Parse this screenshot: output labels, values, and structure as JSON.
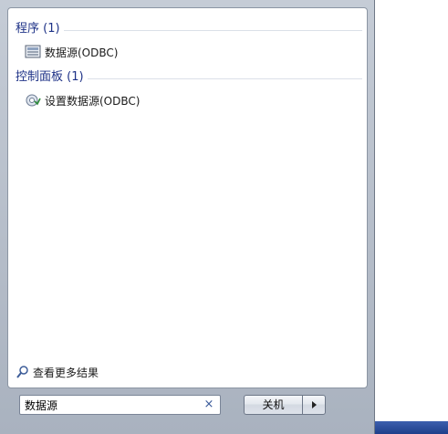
{
  "groups": {
    "programs": {
      "header": "程序 (1)",
      "items": [
        {
          "label": "数据源(ODBC)",
          "icon": "odbc-datasource-icon"
        }
      ]
    },
    "control_panel": {
      "header": "控制面板 (1)",
      "items": [
        {
          "label": "设置数据源(ODBC)",
          "icon": "odbc-settings-icon"
        }
      ]
    }
  },
  "see_more": {
    "label": "查看更多结果",
    "icon": "magnifier-icon"
  },
  "search": {
    "value": "数据源",
    "clear_symbol": "×"
  },
  "shutdown": {
    "label": "关机"
  },
  "colors": {
    "header": "#1e3287",
    "frame": "#b4bcc8",
    "taskbar": "#1f3f8a"
  }
}
